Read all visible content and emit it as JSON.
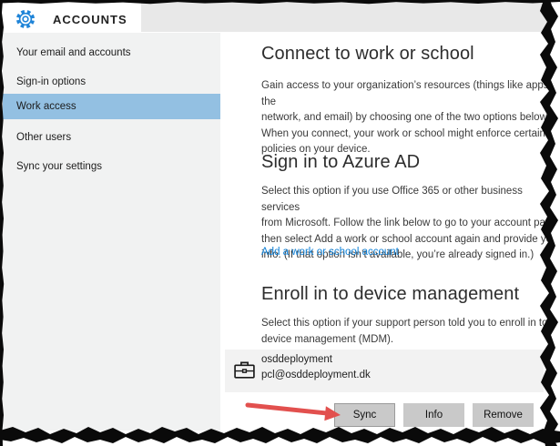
{
  "header": {
    "title": "ACCOUNTS"
  },
  "sidebar": {
    "items": [
      {
        "label": "Your email and accounts",
        "selected": false
      },
      {
        "label": "Sign-in options",
        "selected": false
      },
      {
        "label": "Work access",
        "selected": true
      },
      {
        "label": "Other users",
        "selected": false
      },
      {
        "label": "Sync your settings",
        "selected": false
      }
    ]
  },
  "content": {
    "connect": {
      "heading": "Connect to work or school",
      "body": "Gain access to your organization’s resources (things like apps, the\nnetwork, and email) by choosing one of the two options below.\nWhen you connect, your work or school might enforce certain\npolicies on your device."
    },
    "azure": {
      "heading": "Sign in to Azure AD",
      "body": "Select this option if you use Office 365 or other business services\nfrom Microsoft. Follow the link below to go to your account page,\nthen select Add a work or school account again and provide your\ninfo. (If that option isn’t available, you’re already signed in.)",
      "link": "Add a work or school account"
    },
    "mdm": {
      "heading": "Enroll in to device management",
      "body": "Select this option if your support person told you to enroll in to\ndevice management (MDM).",
      "account": {
        "name": "osddeployment",
        "email": "pcl@osddeployment.dk"
      },
      "buttons": [
        "Sync",
        "Info",
        "Remove"
      ]
    }
  },
  "colors": {
    "accent_blue": "#1f84d8",
    "link_blue": "#0e80d7",
    "highlight_blue": "#93c0e2",
    "arrow_red": "#e2504e",
    "button_gray": "#c9c9c9",
    "box_gray": "#f2f2f2",
    "sidebar_gray": "#f1f2f2",
    "header_gray": "#e8e8e8"
  }
}
